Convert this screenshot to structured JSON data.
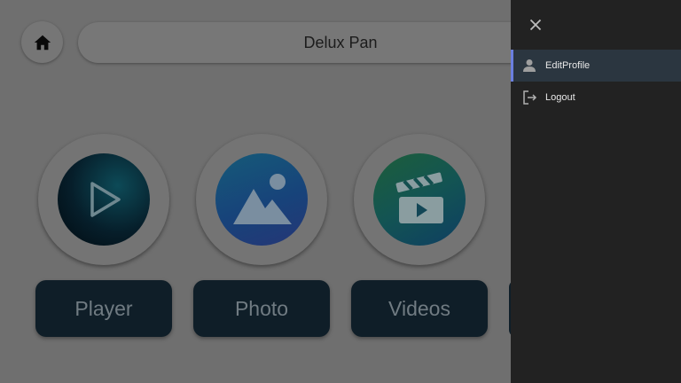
{
  "header": {
    "title": "Delux Pan"
  },
  "tiles": [
    {
      "label": "Player",
      "icon": "play-icon"
    },
    {
      "label": "Photo",
      "icon": "image-icon"
    },
    {
      "label": "Videos",
      "icon": "clapperboard-icon"
    }
  ],
  "drawer": {
    "close_icon": "close-icon",
    "items": [
      {
        "label": "EditProfile",
        "icon": "person-icon",
        "selected": true
      },
      {
        "label": "Logout",
        "icon": "logout-icon",
        "selected": false
      }
    ]
  },
  "colors": {
    "drawer_bg": "#222222",
    "selected_accent": "#6b7fe0",
    "tile_label_bg": "#0f1e28"
  }
}
